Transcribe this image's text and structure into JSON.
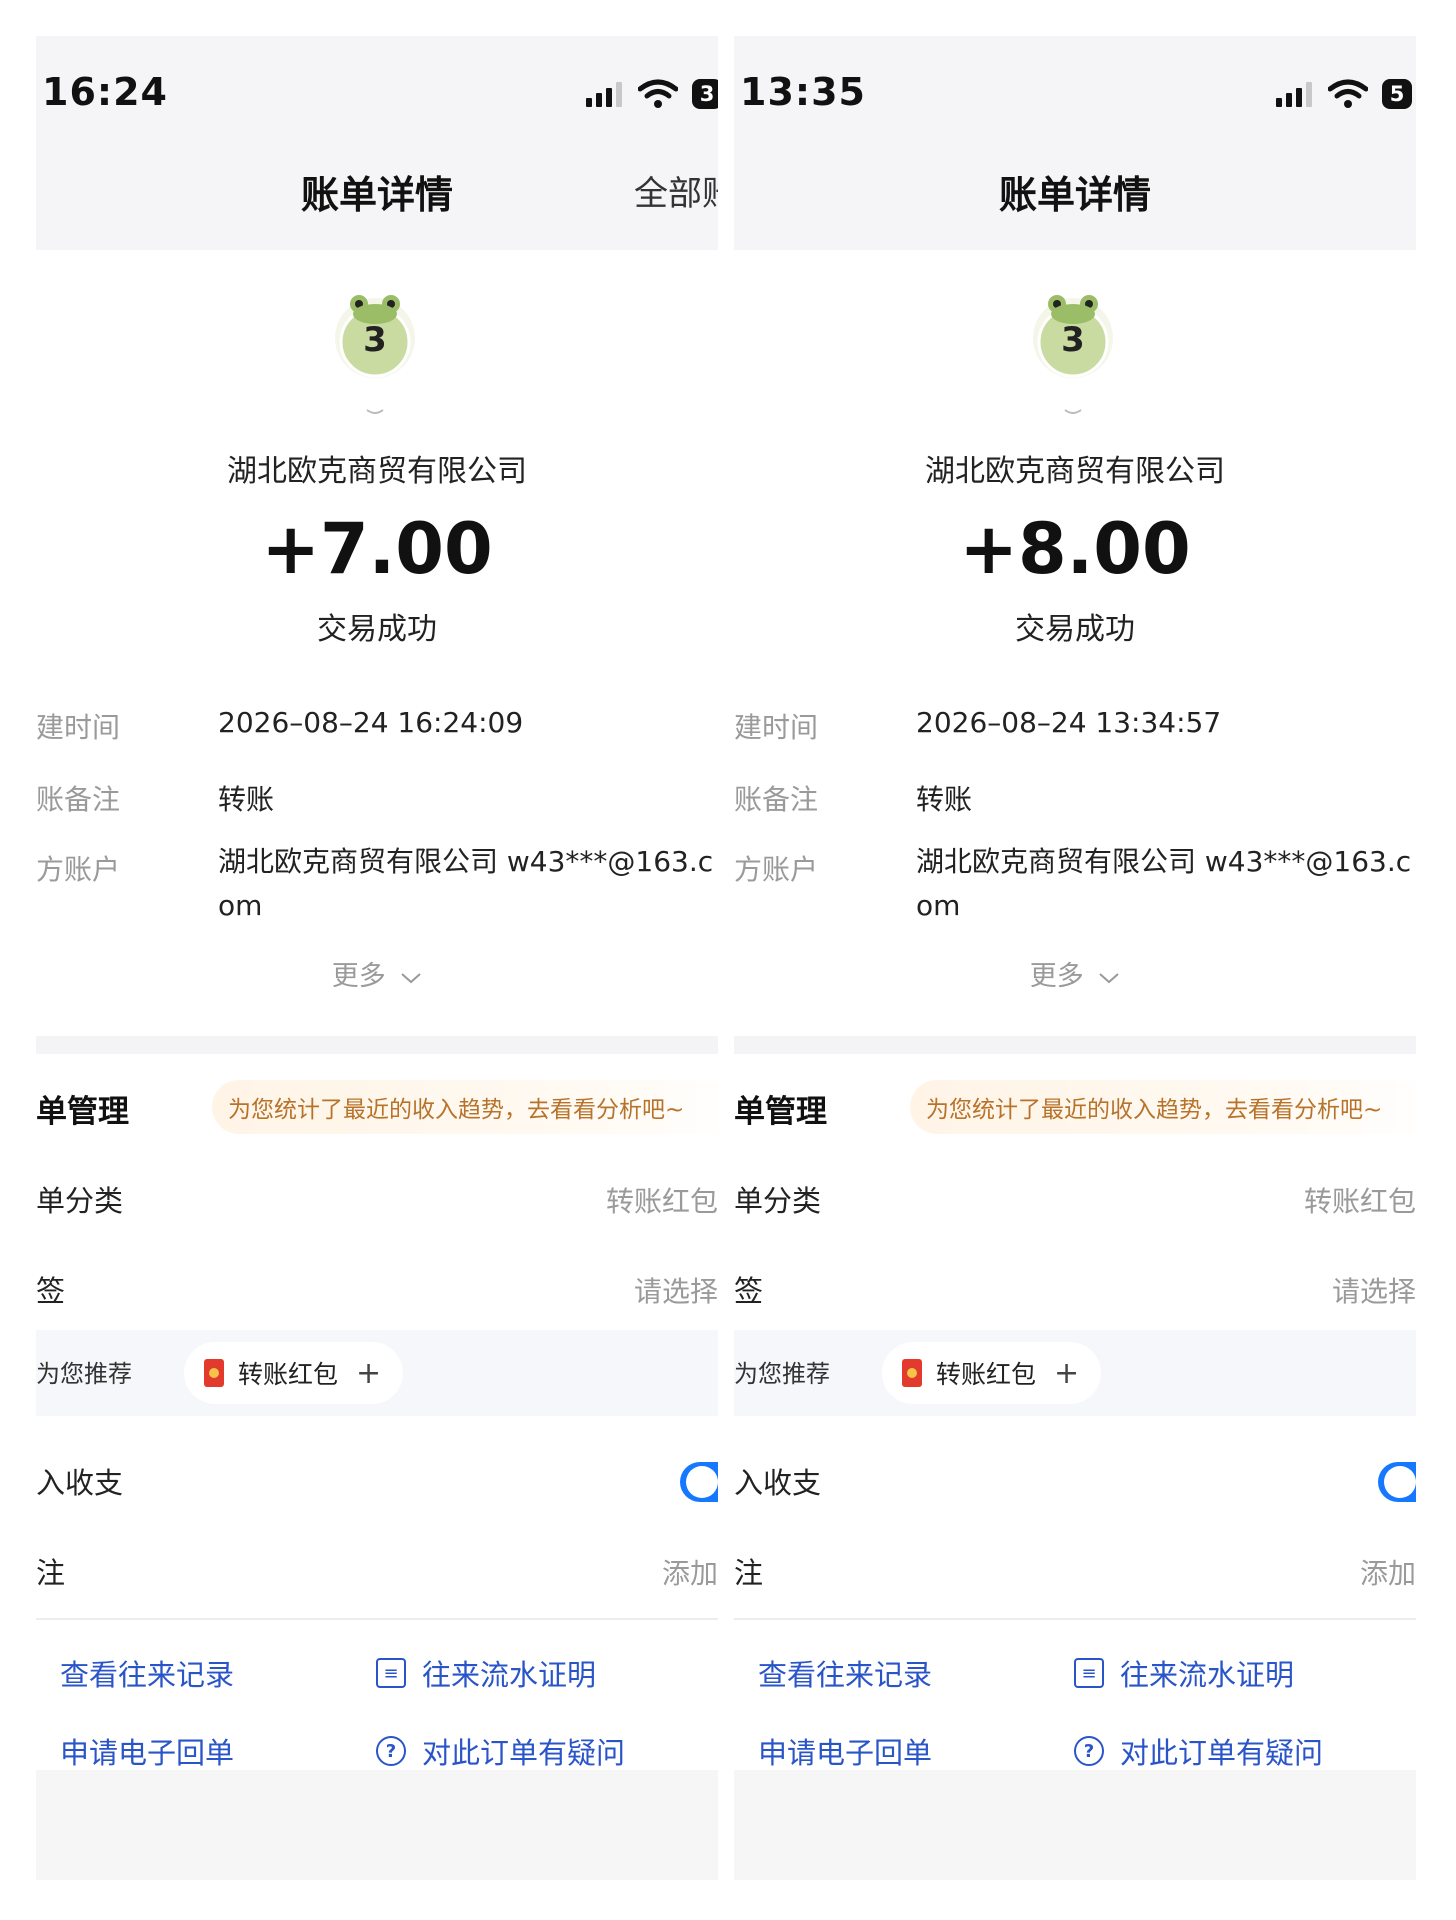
{
  "panels": [
    {
      "time": "16:24",
      "battery": "3",
      "title": "账单详情",
      "title_right": "全部账",
      "avatar_number": "3",
      "counterparty": "湖北欧克商贸有限公司",
      "amount": "+7.00",
      "status": "交易成功",
      "details": [
        {
          "label": "建时间",
          "value": "2026–08–24 16:24:09"
        },
        {
          "label": "账备注",
          "value": "转账"
        },
        {
          "label": "方账户",
          "value": "湖北欧克商贸有限公司 w43***@163.com"
        }
      ],
      "more": "更多",
      "management_title": "单管理",
      "hint": "为您统计了最近的收入趋势，去看看分析吧~",
      "category_label": "单分类",
      "category_value": "转账红包",
      "tag_label": "签",
      "tag_value": "请选择",
      "recommend_label": "为您推荐",
      "recommend_chip": "转账红包",
      "income_label": "入收支",
      "note_label": "注",
      "note_value": "添加",
      "links": [
        "查看往来记录",
        "往来流水证明",
        "申请电子回单",
        "对此订单有疑问"
      ]
    },
    {
      "time": "13:35",
      "battery": "5",
      "title": "账单详情",
      "title_right": "",
      "avatar_number": "3",
      "counterparty": "湖北欧克商贸有限公司",
      "amount": "+8.00",
      "status": "交易成功",
      "details": [
        {
          "label": "建时间",
          "value": "2026–08–24 13:34:57"
        },
        {
          "label": "账备注",
          "value": "转账"
        },
        {
          "label": "方账户",
          "value": "湖北欧克商贸有限公司 w43***@163.com"
        }
      ],
      "more": "更多",
      "management_title": "单管理",
      "hint": "为您统计了最近的收入趋势，去看看分析吧~",
      "category_label": "单分类",
      "category_value": "转账红包",
      "tag_label": "签",
      "tag_value": "请选择",
      "recommend_label": "为您推荐",
      "recommend_chip": "转账红包",
      "income_label": "入收支",
      "note_label": "注",
      "note_value": "添加",
      "links": [
        "查看往来记录",
        "往来流水证明",
        "申请电子回单",
        "对此订单有疑问"
      ]
    }
  ],
  "colors": {
    "accent": "#1677ff",
    "link": "#2a55c8",
    "hint_text": "#b8732b"
  },
  "icons": [
    "signal-icon",
    "wifi-icon",
    "battery-icon",
    "frog-avatar-icon",
    "chevron-down-icon",
    "red-packet-icon",
    "plus-icon",
    "document-icon",
    "question-icon"
  ]
}
